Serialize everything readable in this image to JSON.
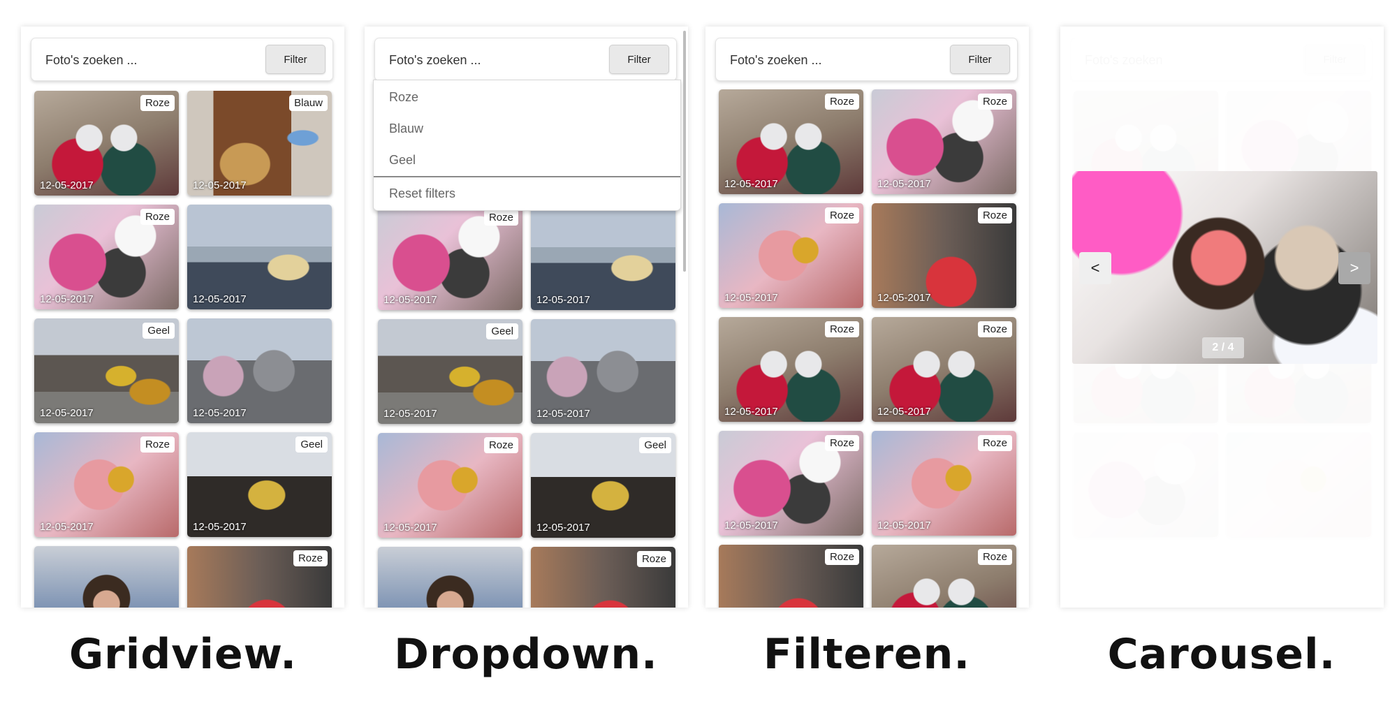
{
  "panels": {
    "gridview": {
      "search_placeholder": "Foto's zoeken ...",
      "filter_label": "Filter",
      "tiles": [
        {
          "tag": "Roze",
          "date": "12-05-2017"
        },
        {
          "tag": "Blauw",
          "date": "12-05-2017"
        },
        {
          "tag": "Roze",
          "date": "12-05-2017"
        },
        {
          "tag": "",
          "date": "12-05-2017"
        },
        {
          "tag": "Geel",
          "date": "12-05-2017"
        },
        {
          "tag": "",
          "date": "12-05-2017"
        },
        {
          "tag": "Roze",
          "date": "12-05-2017"
        },
        {
          "tag": "Geel",
          "date": "12-05-2017"
        },
        {
          "tag": "",
          "date": ""
        },
        {
          "tag": "Roze",
          "date": ""
        }
      ]
    },
    "dropdown": {
      "search_placeholder": "Foto's zoeken ...",
      "filter_label": "Filter",
      "options": [
        "Roze",
        "Blauw",
        "Geel"
      ],
      "reset_label": "Reset filters",
      "tiles": [
        {
          "tag": "Roze",
          "date": "12-05-2017"
        },
        {
          "tag": "",
          "date": "12-05-2017"
        },
        {
          "tag": "Geel",
          "date": "12-05-2017"
        },
        {
          "tag": "",
          "date": "12-05-2017"
        },
        {
          "tag": "Roze",
          "date": "12-05-2017"
        },
        {
          "tag": "Geel",
          "date": "12-05-2017"
        },
        {
          "tag": "",
          "date": ""
        },
        {
          "tag": "Roze",
          "date": ""
        }
      ]
    },
    "filteren": {
      "search_placeholder": "Foto's zoeken ...",
      "filter_label": "Filter",
      "tiles": [
        {
          "tag": "Roze",
          "date": "12-05-2017"
        },
        {
          "tag": "Roze",
          "date": "12-05-2017"
        },
        {
          "tag": "Roze",
          "date": "12-05-2017"
        },
        {
          "tag": "Roze",
          "date": "12-05-2017"
        },
        {
          "tag": "Roze",
          "date": "12-05-2017"
        },
        {
          "tag": "Roze",
          "date": "12-05-2017"
        },
        {
          "tag": "Roze",
          "date": "12-05-2017"
        },
        {
          "tag": "Roze",
          "date": "12-05-2017"
        },
        {
          "tag": "Roze",
          "date": ""
        },
        {
          "tag": "Roze",
          "date": ""
        }
      ]
    },
    "carousel": {
      "search_placeholder": "Foto's zoeken",
      "filter_label": "Filter",
      "prev_label": "<",
      "next_label": ">",
      "indicator": "2 / 4"
    }
  },
  "captions": [
    "Gridview.",
    "Dropdown.",
    "Filteren.",
    "Carousel."
  ]
}
